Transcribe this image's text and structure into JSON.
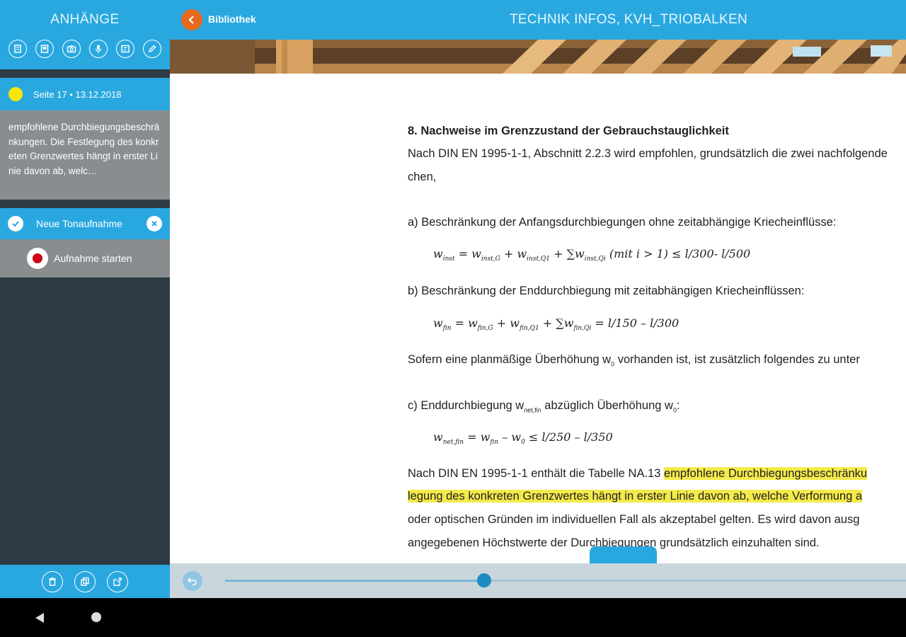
{
  "sidebar": {
    "title": "ANHÄNGE",
    "tools": [
      "note-icon",
      "page-icon",
      "camera-icon",
      "microphone-icon",
      "text-icon",
      "pencil-icon"
    ],
    "note": {
      "header": "Seite 17 • 13.12.2018",
      "dot_color": "#f6e60e",
      "text": "empfohlene Durchbiegungsbeschränkungen. Die Festlegung des konkreten Grenzwertes hängt in erster Linie davon ab, welc…"
    },
    "recording": {
      "title": "Neue Tonaufnahme",
      "start_label": "Aufnahme starten"
    },
    "footer_buttons": [
      "trash-icon",
      "copy-icon",
      "share-icon"
    ]
  },
  "topbar": {
    "back_label": "Bibliothek",
    "title": "TECHNIK INFOS, KVH_TRIOBALKEN"
  },
  "document": {
    "heading": "8. Nachweise im Grenzzustand der Gebrauchstauglichkeit",
    "p1_a": "Nach DIN EN 1995-1-1, Abschnitt 2.2.3 wird empfohlen, grundsätzlich die zwei nachfolgende",
    "p1_b": "chen,",
    "a_label": "a) Beschränkung der Anfangsdurchbiegungen ohne zeitabhängige Kriecheinflüsse:",
    "b_label": "b) Beschränkung der Enddurchbiegung mit zeitabhängigen Kriecheinflüssen:",
    "sofern": "Sofern eine planmäßige Überhöhung w",
    "sofern_sub": "0",
    "sofern_rest": " vorhanden ist, ist zusätzlich folgendes zu unter",
    "c_label_a": "c) Enddurchbiegung w",
    "c_label_sub": "net,fin",
    "c_label_b": " abzüglich Überhöhung w",
    "c_label_sub2": "0",
    "c_label_c": ":",
    "last_1a": "Nach DIN EN 1995-1-1 enthält die Tabelle NA.13 ",
    "last_1b": "empfohlene Durchbiegungsbeschränku",
    "last_2": "legung des konkreten Grenzwertes hängt in erster Linie davon ab, welche Verformung a",
    "last_3": "oder optischen Gründen im individuellen Fall als akzeptabel gelten. Es wird davon ausg",
    "last_4": "angegebenen Höchstwerte der Durchbiegungen grundsätzlich einzuhalten sind."
  },
  "slider": {
    "progress": 0.38
  },
  "colors": {
    "accent": "#29a8e0",
    "back_button": "#e6691e",
    "highlight": "#f4ea4a",
    "record": "#d0021b"
  }
}
